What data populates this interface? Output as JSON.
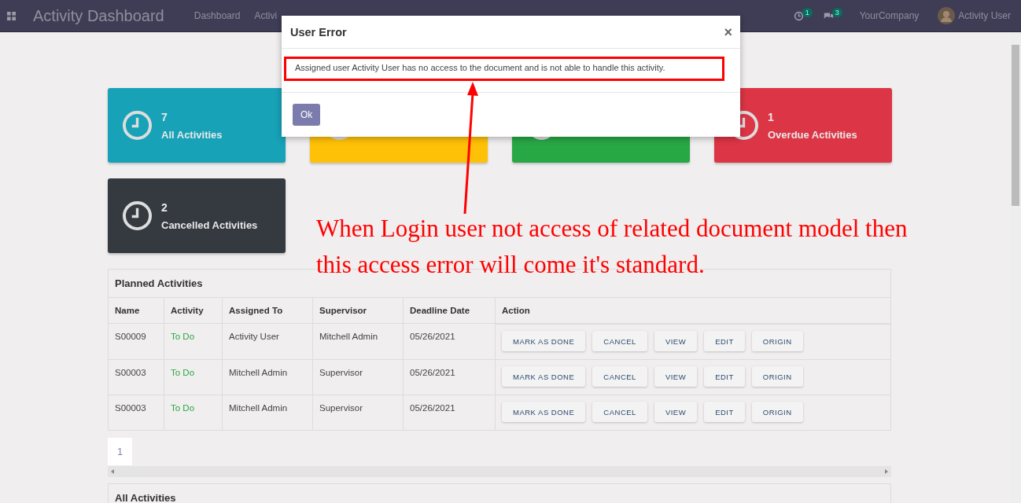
{
  "navbar": {
    "title": "Activity Dashboard",
    "menu": [
      "Dashboard",
      "Activi"
    ],
    "activity_count": "1",
    "message_count": "3",
    "company": "YourCompany",
    "user": "Activity User"
  },
  "cards": [
    {
      "count": "7",
      "label": "All Activities",
      "color": "#17a2b8"
    },
    {
      "color": "#ffc107"
    },
    {
      "color": "#28a745"
    },
    {
      "count": "1",
      "label": "Overdue Activities",
      "color": "#dc3545"
    },
    {
      "count": "2",
      "label": "Cancelled Activities",
      "color": "#343a40"
    }
  ],
  "planned": {
    "title": "Planned Activities",
    "columns": [
      "Name",
      "Activity",
      "Assigned To",
      "Supervisor",
      "Deadline Date",
      "Action"
    ],
    "rows": [
      {
        "name": "S00009",
        "activity": "To Do",
        "assigned": "Activity User",
        "supervisor": "Mitchell Admin",
        "deadline": "05/26/2021",
        "actions": [
          "MARK AS DONE",
          "CANCEL",
          "VIEW",
          "EDIT",
          "ORIGIN"
        ]
      },
      {
        "name": "S00003",
        "activity": "To Do",
        "assigned": "Mitchell Admin",
        "supervisor": "Supervisor",
        "deadline": "05/26/2021",
        "actions": [
          "MARK AS DONE",
          "CANCEL",
          "VIEW",
          "EDIT",
          "ORIGIN"
        ]
      },
      {
        "name": "S00003",
        "activity": "To Do",
        "assigned": "Mitchell Admin",
        "supervisor": "Supervisor",
        "deadline": "05/26/2021",
        "actions": [
          "MARK AS DONE",
          "CANCEL",
          "VIEW",
          "EDIT",
          "ORIGIN"
        ]
      }
    ],
    "pages": [
      {
        "label": "1",
        "selected": true
      }
    ]
  },
  "all_title": "All Activities",
  "dialog": {
    "title": "User Error",
    "close": "×",
    "message": "Assigned user Activity User has no access to the document and is not able to handle this activity.",
    "button": "Ok"
  },
  "annotation": "When Login user not access of related document model then this access error will come it's standard."
}
